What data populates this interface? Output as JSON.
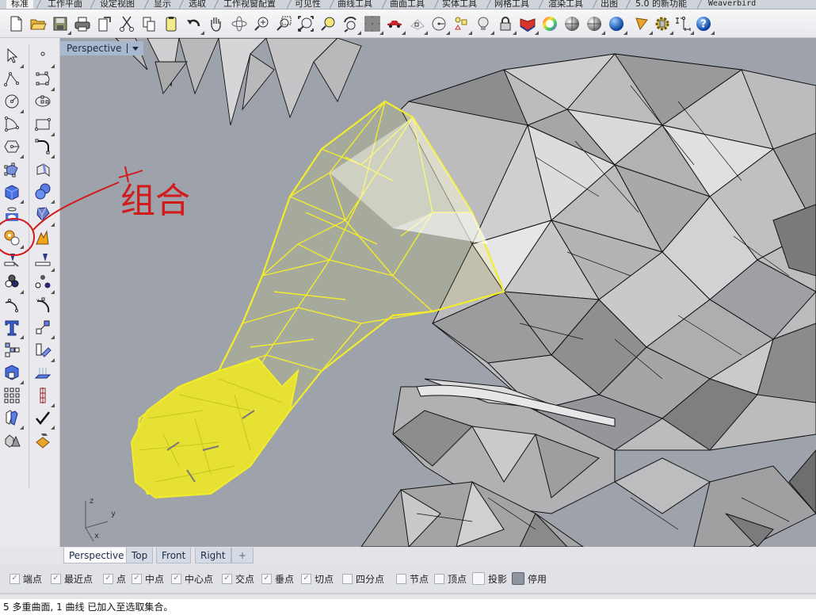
{
  "menu_tabs": [
    {
      "label": "标准",
      "active": true
    },
    {
      "label": "工作平面"
    },
    {
      "label": "设定视图"
    },
    {
      "label": "显示"
    },
    {
      "label": "选取"
    },
    {
      "label": "工作视窗配置"
    },
    {
      "label": "可见性"
    },
    {
      "label": "曲线工具"
    },
    {
      "label": "曲面工具"
    },
    {
      "label": "实体工具"
    },
    {
      "label": "网格工具"
    },
    {
      "label": "渲染工具"
    },
    {
      "label": "出图"
    },
    {
      "label": "5.0 的新功能"
    },
    {
      "label": "Weaverbird"
    }
  ],
  "toolbar_icons": [
    "new-file",
    "open-folder",
    "save",
    "print",
    "import",
    "cut",
    "copy",
    "paste",
    "undo",
    "pan-hand",
    "rotate-view",
    "zoom-dynamic",
    "zoom-window",
    "zoom-extents",
    "zoom-selected",
    "undo-view",
    "four-viewports",
    "car-render",
    "grid-snap",
    "cplane",
    "selection-filter",
    "light-bulb",
    "lock",
    "layer-material",
    "color-wheel",
    "sphere-shaded",
    "sphere-rendered",
    "sphere-blue",
    "move-cone",
    "gear-options",
    "dimension",
    "help"
  ],
  "left_tools": [
    [
      "select-arrow",
      "point"
    ],
    [
      "polyline",
      "curve-control-points"
    ],
    [
      "circle",
      "ellipse"
    ],
    [
      "arc",
      "rectangle"
    ],
    [
      "polygon",
      "fillet-curve"
    ],
    [
      "surface-from-points",
      "extrude-surface"
    ],
    [
      "box-solid",
      "boolean-union"
    ],
    [
      "cylinder-solid",
      "mesh-tools"
    ],
    [
      "join",
      "explode"
    ],
    [
      "trim",
      "split"
    ],
    [
      "group",
      "ungroup"
    ],
    [
      "curve-point",
      "rebuild-curve"
    ],
    [
      "text",
      "move"
    ],
    [
      "array",
      "copy-transform"
    ],
    [
      "solid-edit",
      "extrude-up"
    ],
    [
      "array-grid",
      "ortho"
    ],
    [
      "bend",
      "check"
    ],
    [
      "shapes",
      "paint-bucket"
    ]
  ],
  "viewport": {
    "title": "Perspective",
    "axis_labels": {
      "z": "z",
      "y": "y",
      "x": "x"
    },
    "annotation_text": "组合",
    "colors": {
      "background": "#9ea3ab",
      "selection": "#f2ec2a",
      "mesh_edge": "#111111",
      "annotation": "#d11a1a"
    }
  },
  "view_tabs": [
    {
      "label": "Perspective",
      "active": true
    },
    {
      "label": "Top"
    },
    {
      "label": "Front"
    },
    {
      "label": "Right"
    },
    {
      "label": "+"
    }
  ],
  "osnaps": [
    {
      "label": "端点",
      "checked": true
    },
    {
      "label": "最近点",
      "checked": true
    },
    {
      "label": "点",
      "checked": true
    },
    {
      "label": "中点",
      "checked": true
    },
    {
      "label": "中心点",
      "checked": true
    },
    {
      "label": "交点",
      "checked": true
    },
    {
      "label": "垂点",
      "checked": true
    },
    {
      "label": "切点",
      "checked": true
    },
    {
      "label": "四分点",
      "checked": false
    },
    {
      "label": "节点",
      "checked": false
    },
    {
      "label": "顶点",
      "checked": false
    },
    {
      "label": "投影",
      "checked": false
    },
    {
      "label": "停用",
      "checked": false
    }
  ],
  "command_line": "5 多重曲面, 1 曲线 已加入至选取集合。"
}
